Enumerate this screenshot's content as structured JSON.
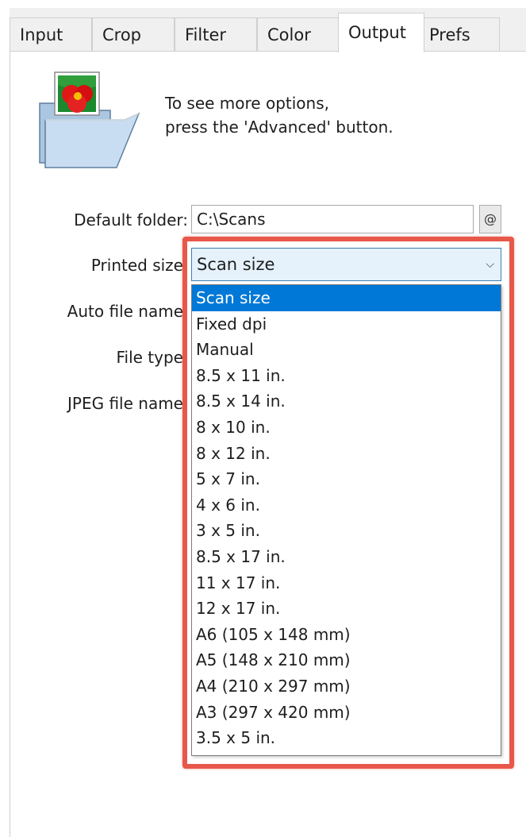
{
  "tabs": [
    {
      "label": "Input"
    },
    {
      "label": "Crop"
    },
    {
      "label": "Filter"
    },
    {
      "label": "Color"
    },
    {
      "label": "Output"
    },
    {
      "label": "Prefs"
    }
  ],
  "active_tab": "Output",
  "hint": {
    "line1": "To see more options,",
    "line2": "press the 'Advanced' button."
  },
  "labels": {
    "default_folder": "Default folder:",
    "printed_size": "Printed size",
    "auto_file_name": "Auto file name",
    "file_type": "File type",
    "jpeg_file_name": "JPEG file name"
  },
  "default_folder_value": "C:\\Scans",
  "browse_button_label": "@",
  "printed_size": {
    "selected": "Scan size",
    "options": [
      "Scan size",
      "Fixed dpi",
      "Manual",
      "8.5 x 11 in.",
      "8.5 x 14 in.",
      "8 x 10 in.",
      "8 x 12 in.",
      "5 x 7 in.",
      "4 x 6 in.",
      "3 x 5 in.",
      "8.5 x 17 in.",
      "11 x 17 in.",
      "12 x 17 in.",
      "A6 (105 x 148 mm)",
      "A5 (148 x 210 mm)",
      "A4 (210 x 297 mm)",
      "A3 (297 x 420 mm)",
      "3.5 x 5 in."
    ]
  },
  "icons": {
    "folder": "folder-with-photo-icon",
    "dropdown": "chevron-down-icon"
  },
  "colors": {
    "highlight": "#e8584a",
    "selection": "#0078d7",
    "select_focus_bg": "#e5f1fb"
  }
}
